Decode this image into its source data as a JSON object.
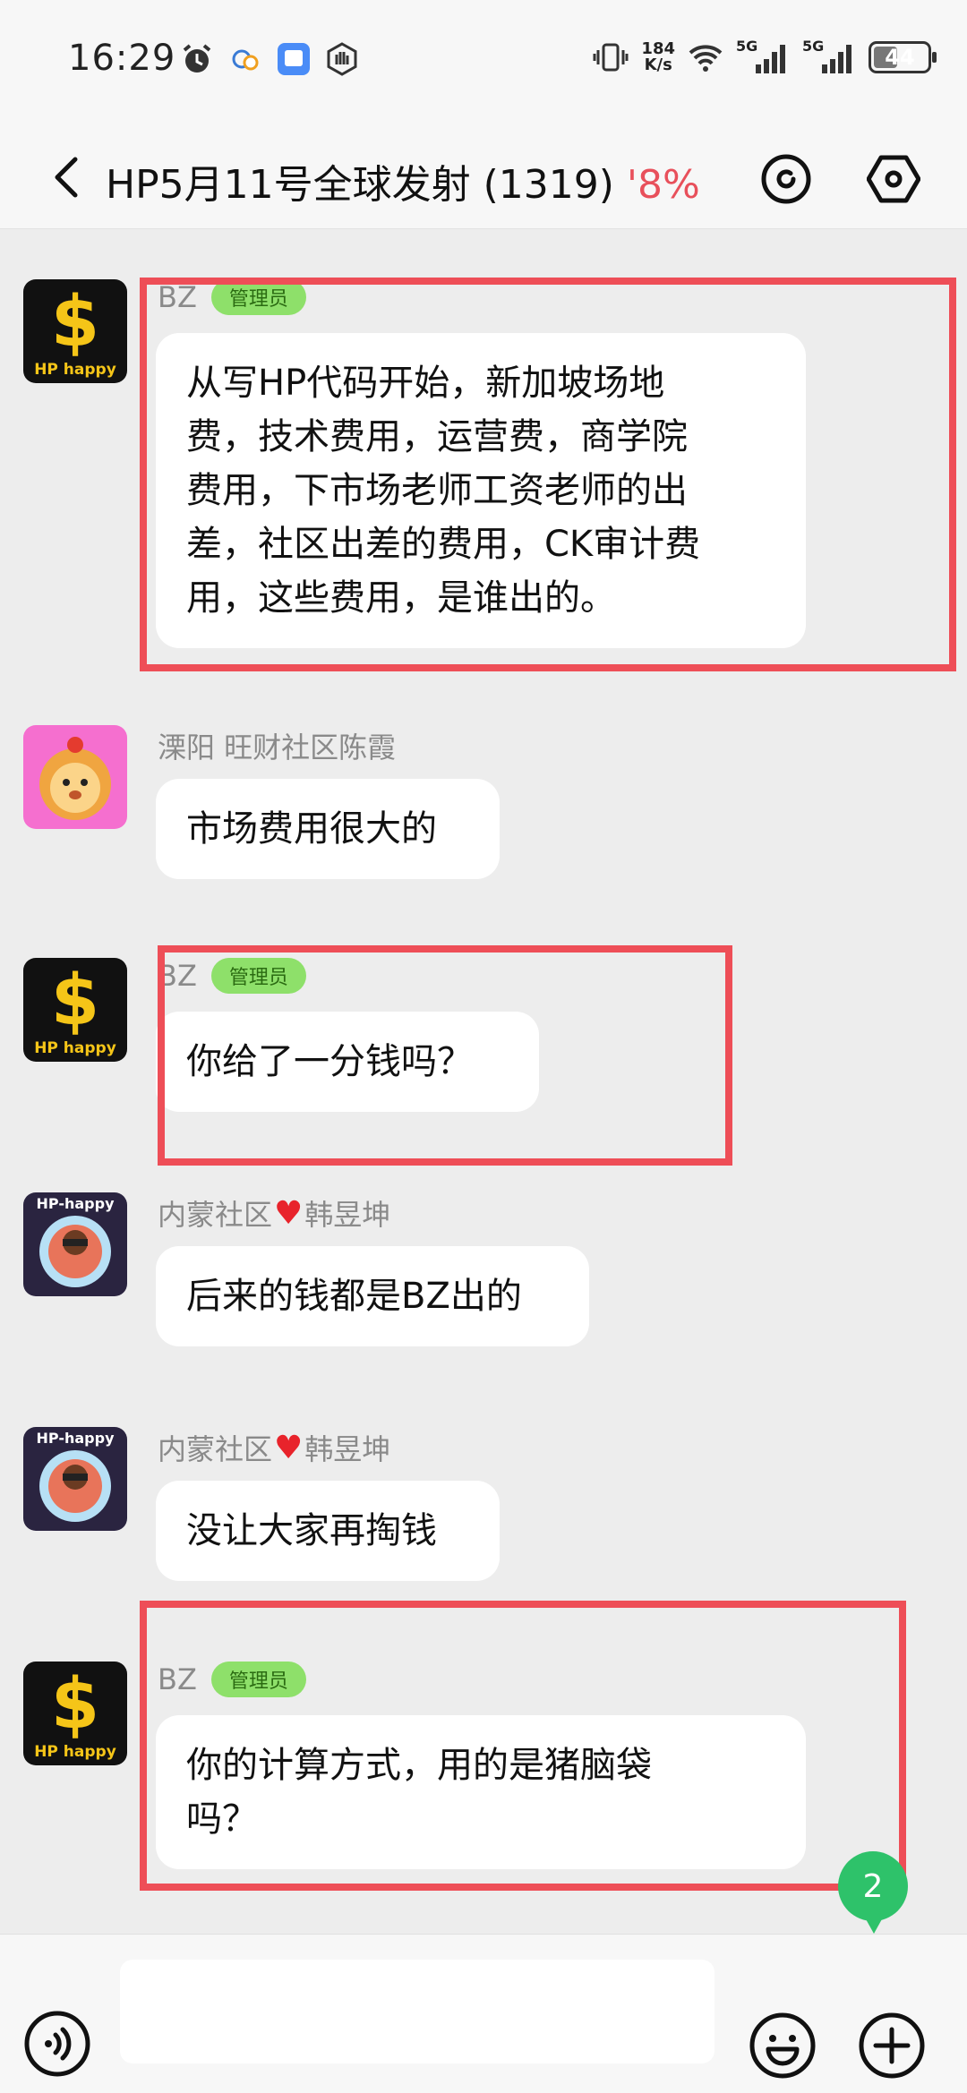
{
  "status_bar": {
    "time": "16:29",
    "net_speed_value": "184",
    "net_speed_unit": "K/s",
    "signal1_label": "5G",
    "signal2_label": "5G",
    "battery_percent": "44",
    "battery_level": 0.44
  },
  "header": {
    "title": "HP5月11号全球发射 (1319)",
    "percent": "'8%"
  },
  "messages": [
    {
      "sender": "BZ",
      "badge": "管理员",
      "avatar": "hp-happy-dollar-logo",
      "lines": [
        "从写HP代码开始，新加坡场地",
        "费，技术费用，运营费，商学院",
        "费用，下市场老师工资老师的出",
        "差，社区出差的费用，CK审计费",
        "用，这些费用，是谁出的。"
      ]
    },
    {
      "sender": "溧阳 旺财社区陈霞",
      "avatar": "cartoon-lion-avatar",
      "lines": [
        "市场费用很大的"
      ]
    },
    {
      "sender": "BZ",
      "badge": "管理员",
      "avatar": "hp-happy-dollar-logo",
      "lines": [
        "你给了一分钱吗？"
      ]
    },
    {
      "sender_prefix": "内蒙社区",
      "sender_suffix": "韩昱坤",
      "avatar": "hp-happy-character-avatar",
      "lines": [
        "后来的钱都是BZ出的"
      ]
    },
    {
      "sender_prefix": "内蒙社区",
      "sender_suffix": "韩昱坤",
      "avatar": "hp-happy-character-avatar",
      "lines": [
        "没让大家再掏钱"
      ]
    },
    {
      "sender": "BZ",
      "badge": "管理员",
      "avatar": "hp-happy-dollar-logo",
      "lines": [
        "你的计算方式，用的是猪脑袋",
        "吗？"
      ]
    }
  ],
  "unread_badge": "2",
  "input": {
    "placeholder": ""
  },
  "avatar_text": {
    "logo": "HP happy",
    "character": "HP-happy"
  },
  "colors": {
    "highlight_box": "#ee4e57",
    "admin_badge_bg": "#8ee06a",
    "unread_badge": "#2ec26a",
    "header_percent": "#e8505b"
  }
}
